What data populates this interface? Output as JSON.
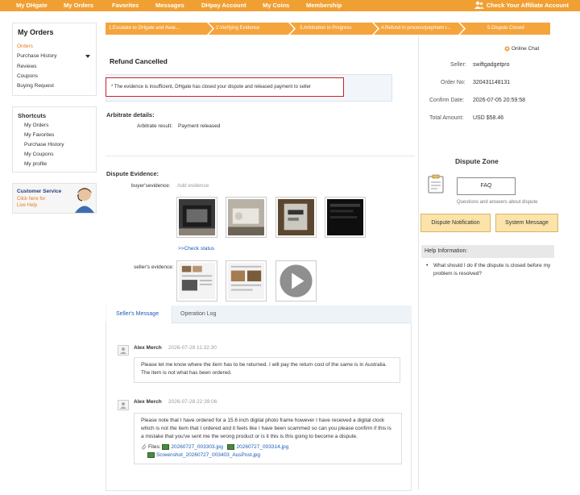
{
  "topnav": {
    "items": [
      "My DHgate",
      "My Orders",
      "Favorites",
      "Messages",
      "DHpay Account",
      "My Coins",
      "Membership"
    ],
    "affiliate": "Check Your Affiliate Account"
  },
  "sidebar": {
    "title": "My Orders",
    "items": [
      "Orders",
      "Purchase History",
      "Reviews",
      "Coupons",
      "Buying Request"
    ],
    "shortcuts_title": "Shortcuts",
    "shortcuts": [
      "My Orders",
      "My Favorites",
      "Purchase History",
      "My Coupons",
      "My profile"
    ],
    "customer_service": {
      "title": "Customer Service",
      "line1": "Click here for",
      "line2": "Live Help"
    }
  },
  "steps": [
    "1.Escalate to DHgate and Awai...",
    "2.Verifying Evidence",
    "3.Arbitration in Progress",
    "4.Refund in process/payment r...",
    "5.Dispute Closed"
  ],
  "main": {
    "status_title": "Refund Cancelled",
    "notice": "* The evidence is insufficient, DHgate has closed your dispute and released payment to seller",
    "arbitrate_heading": "Arbitrate details:",
    "arbitrate_label": "Arbitrate result:",
    "arbitrate_value": "Payment released",
    "evidence_heading": "Dispute Evidence:",
    "buyer_label": "buyer'sevidence:",
    "add_evidence": "Add evidence",
    "check_status": ">>Check status",
    "seller_label": "seller's evidence:"
  },
  "tabs": [
    "Seller's Message",
    "Operation Log"
  ],
  "messages": [
    {
      "author": "Alex Merch",
      "time": "2026-07-29 11:32:30",
      "text": "Please let me know where the item has to be returned. I will pay the return cost of the same is in Australia. The item is not what has been ordered."
    },
    {
      "author": "Alex Merch",
      "time": "2026-07-28 22:39:06",
      "text": "Please note that I have ordered for a 15.6 inch digital photo frame however I have received a digital clock which is not the item that I ordered and it feels like I have been scammed so can you please confirm if this is a mistake that you've sent me the wrong product or is it this is this going to become a dispute.",
      "files_label": "Files:",
      "files": [
        "20260727_003303.jpg",
        "20260727_003314.jpg",
        "Screenshot_20260727_003403_AusPost.jpg"
      ]
    }
  ],
  "order_info": {
    "online_chat": "Online Chat",
    "seller_label": "Seller:",
    "seller_value": "swiftgadgetpro",
    "order_label": "Order No:",
    "order_value": "320431148131",
    "confirm_label": "Confirm Date:",
    "confirm_value": "2026-07-05 20:59:58",
    "total_label": "Total Amount:",
    "total_value": "USD $58.46"
  },
  "dispute_zone": {
    "title": "Dispute Zone",
    "faq": "FAQ",
    "faq_caption": "Questions and answers about dispute",
    "notification_btn": "Dispute Notification",
    "system_btn": "System Message"
  },
  "help": {
    "title": "Help Information:",
    "item": "What should I do if the dispute is closed before my problem is resolved?"
  },
  "colors": {
    "brand": "#f0a033",
    "step": "#f5a43c",
    "accent_link": "#e8791c",
    "notice_border": "#c8202a",
    "link": "#1a5cb8"
  }
}
